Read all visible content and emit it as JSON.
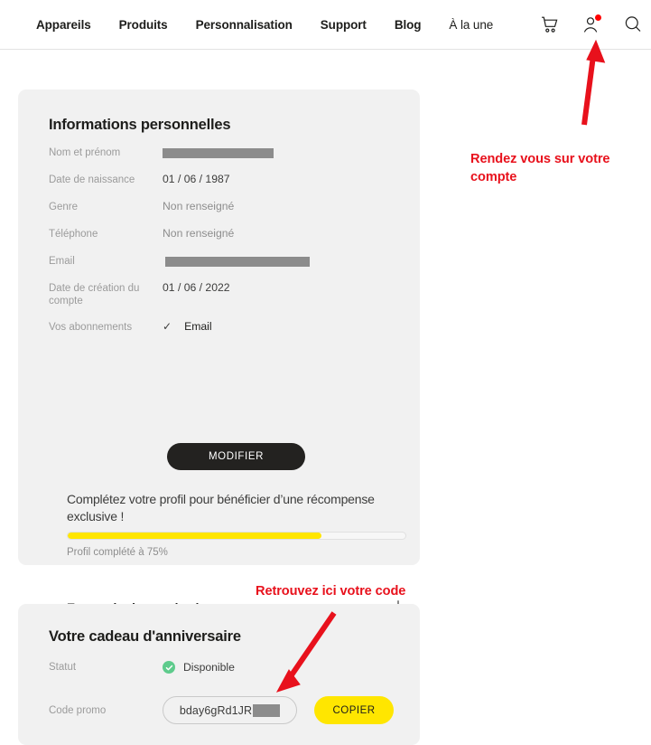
{
  "nav": {
    "links": [
      {
        "label": "Appareils",
        "bold": true
      },
      {
        "label": "Produits",
        "bold": true
      },
      {
        "label": "Personnalisation",
        "bold": true
      },
      {
        "label": "Support",
        "bold": true
      },
      {
        "label": "Blog",
        "bold": true
      },
      {
        "label": "À la une",
        "bold": false
      }
    ],
    "icons": {
      "cart": "cart-icon",
      "account": "account-icon",
      "search": "search-icon"
    },
    "notification_dot_color": "#ff0000"
  },
  "personal": {
    "title": "Informations personnelles",
    "rows": [
      {
        "label": "Nom et prénom",
        "value": "",
        "redacted": true
      },
      {
        "label": "Date de naissance",
        "value": "01 / 06 / 1987",
        "redacted": false
      },
      {
        "label": "Genre",
        "value": "Non renseigné",
        "redacted": false
      },
      {
        "label": "Téléphone",
        "value": "Non renseigné",
        "redacted": false
      },
      {
        "label": "Email",
        "value": "",
        "redacted": true
      },
      {
        "label": "Date de création du compte",
        "value": "01 / 06 / 2022",
        "redacted": false
      }
    ],
    "subscriptions": {
      "label": "Vos abonnements",
      "check": "✓",
      "value": "Email"
    },
    "modify_button": "MODIFIER",
    "reward_text": "Complétez votre profil pour bénéficier d’une récompense exclusive !",
    "progress": {
      "percent": 75,
      "label": "Profil complété à 75%",
      "fill_color": "#ffe600"
    },
    "accordion": {
      "title": "En savoir plus sur la récompense",
      "toggle": "plus-icon"
    }
  },
  "gift": {
    "title": "Votre cadeau d'anniversaire",
    "status": {
      "label": "Statut",
      "value": "Disponible",
      "badge_color": "#5ecb8c"
    },
    "promo": {
      "label": "Code promo",
      "code": "bday6gRd1JR",
      "copy_button": "COPIER",
      "button_color": "#ffe600"
    }
  },
  "annotations": {
    "color": "#e8111c",
    "account": "Rendez vous sur votre compte",
    "code": "Retrouvez ici votre code"
  }
}
